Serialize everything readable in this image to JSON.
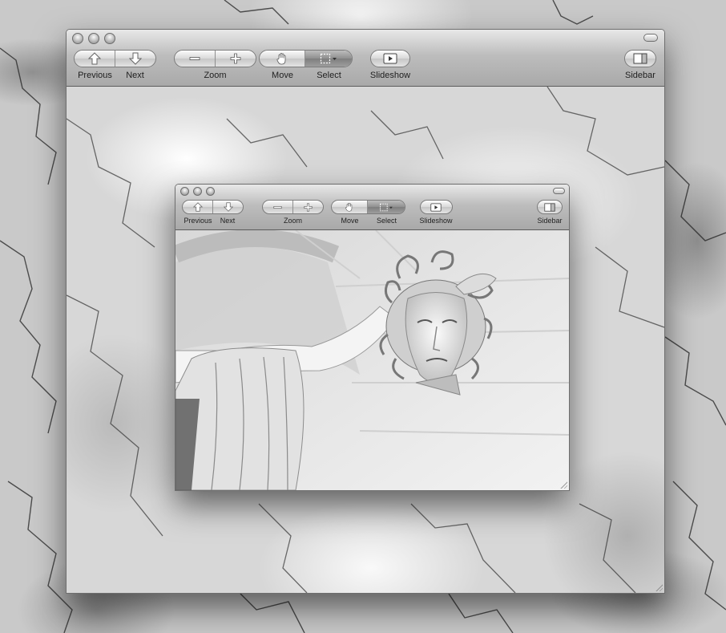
{
  "outer_window": {
    "toolbar": {
      "previous_label": "Previous",
      "next_label": "Next",
      "zoom_label": "Zoom",
      "move_label": "Move",
      "select_label": "Select",
      "slideshow_label": "Slideshow",
      "sidebar_label": "Sidebar"
    }
  },
  "inner_window": {
    "toolbar": {
      "previous_label": "Previous",
      "next_label": "Next",
      "zoom_label": "Zoom",
      "move_label": "Move",
      "select_label": "Select",
      "slideshow_label": "Slideshow",
      "sidebar_label": "Sidebar"
    }
  },
  "icons": {
    "previous": "arrow-up-icon",
    "next": "arrow-down-icon",
    "zoom_out": "minus-icon",
    "zoom_in": "plus-icon",
    "move": "hand-icon",
    "select": "marquee-select-icon",
    "slideshow": "play-icon",
    "sidebar": "sidebar-icon"
  },
  "active_tool": "select"
}
